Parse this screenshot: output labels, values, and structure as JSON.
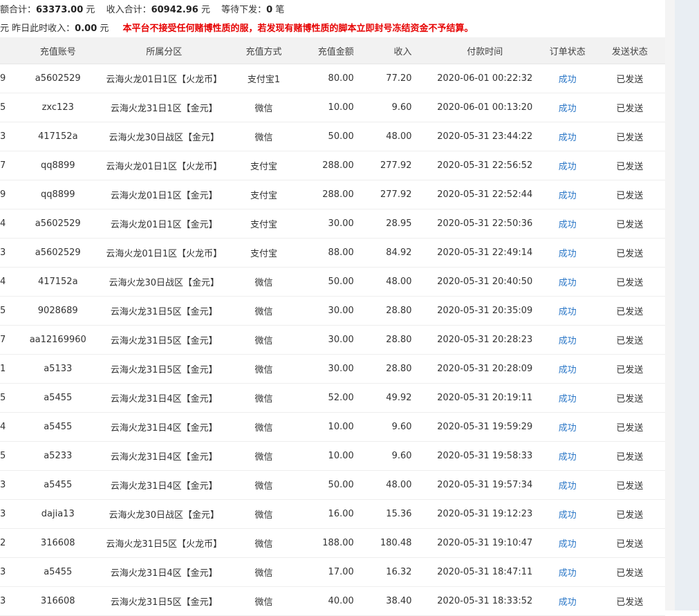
{
  "summary": {
    "total_label": "额合计：",
    "total_value": "63373.00",
    "total_unit": "元",
    "income_label": "收入合计：",
    "income_value": "60942.96",
    "income_unit": "元",
    "pending_label": "等待下发：",
    "pending_value": "0",
    "pending_unit": "笔",
    "unit_prefix": "元",
    "yesterday_label": "昨日此时收入：",
    "yesterday_value": "0.00",
    "yesterday_unit": "元",
    "warning": "本平台不接受任何赌博性质的服，若发现有赌博性质的脚本立即封号冻结资金不予结算。"
  },
  "table": {
    "headers": [
      "",
      "充值账号",
      "所属分区",
      "充值方式",
      "充值金额",
      "收入",
      "付款时间",
      "订单状态",
      "发送状态"
    ],
    "rows": [
      {
        "id": "9",
        "account": "a5602529",
        "zone": "云海火龙01日1区【火龙币】",
        "method": "支付宝1",
        "amount": "80.00",
        "income": "77.20",
        "time": "2020-06-01 00:22:32",
        "status": "成功",
        "send": "已发送"
      },
      {
        "id": "5",
        "account": "zxc123",
        "zone": "云海火龙31日1区【金元】",
        "method": "微信",
        "amount": "10.00",
        "income": "9.60",
        "time": "2020-06-01 00:13:20",
        "status": "成功",
        "send": "已发送"
      },
      {
        "id": "3",
        "account": "417152a",
        "zone": "云海火龙30日战区【金元】",
        "method": "微信",
        "amount": "50.00",
        "income": "48.00",
        "time": "2020-05-31 23:44:22",
        "status": "成功",
        "send": "已发送"
      },
      {
        "id": "7",
        "account": "qq8899",
        "zone": "云海火龙01日1区【火龙币】",
        "method": "支付宝",
        "amount": "288.00",
        "income": "277.92",
        "time": "2020-05-31 22:56:52",
        "status": "成功",
        "send": "已发送"
      },
      {
        "id": "9",
        "account": "qq8899",
        "zone": "云海火龙01日1区【金元】",
        "method": "支付宝",
        "amount": "288.00",
        "income": "277.92",
        "time": "2020-05-31 22:52:44",
        "status": "成功",
        "send": "已发送"
      },
      {
        "id": "4",
        "account": "a5602529",
        "zone": "云海火龙01日1区【金元】",
        "method": "支付宝",
        "amount": "30.00",
        "income": "28.95",
        "time": "2020-05-31 22:50:36",
        "status": "成功",
        "send": "已发送"
      },
      {
        "id": "3",
        "account": "a5602529",
        "zone": "云海火龙01日1区【火龙币】",
        "method": "支付宝",
        "amount": "88.00",
        "income": "84.92",
        "time": "2020-05-31 22:49:14",
        "status": "成功",
        "send": "已发送"
      },
      {
        "id": "4",
        "account": "417152a",
        "zone": "云海火龙30日战区【金元】",
        "method": "微信",
        "amount": "50.00",
        "income": "48.00",
        "time": "2020-05-31 20:40:50",
        "status": "成功",
        "send": "已发送"
      },
      {
        "id": "5",
        "account": "9028689",
        "zone": "云海火龙31日5区【金元】",
        "method": "微信",
        "amount": "30.00",
        "income": "28.80",
        "time": "2020-05-31 20:35:09",
        "status": "成功",
        "send": "已发送"
      },
      {
        "id": "7",
        "account": "aa12169960",
        "zone": "云海火龙31日5区【金元】",
        "method": "微信",
        "amount": "30.00",
        "income": "28.80",
        "time": "2020-05-31 20:28:23",
        "status": "成功",
        "send": "已发送"
      },
      {
        "id": "1",
        "account": "a5133",
        "zone": "云海火龙31日5区【金元】",
        "method": "微信",
        "amount": "30.00",
        "income": "28.80",
        "time": "2020-05-31 20:28:09",
        "status": "成功",
        "send": "已发送"
      },
      {
        "id": "5",
        "account": "a5455",
        "zone": "云海火龙31日4区【金元】",
        "method": "微信",
        "amount": "52.00",
        "income": "49.92",
        "time": "2020-05-31 20:19:11",
        "status": "成功",
        "send": "已发送"
      },
      {
        "id": "4",
        "account": "a5455",
        "zone": "云海火龙31日4区【金元】",
        "method": "微信",
        "amount": "10.00",
        "income": "9.60",
        "time": "2020-05-31 19:59:29",
        "status": "成功",
        "send": "已发送"
      },
      {
        "id": "5",
        "account": "a5233",
        "zone": "云海火龙31日4区【金元】",
        "method": "微信",
        "amount": "10.00",
        "income": "9.60",
        "time": "2020-05-31 19:58:33",
        "status": "成功",
        "send": "已发送"
      },
      {
        "id": "3",
        "account": "a5455",
        "zone": "云海火龙31日4区【金元】",
        "method": "微信",
        "amount": "50.00",
        "income": "48.00",
        "time": "2020-05-31 19:57:34",
        "status": "成功",
        "send": "已发送"
      },
      {
        "id": "3",
        "account": "dajia13",
        "zone": "云海火龙30日战区【金元】",
        "method": "微信",
        "amount": "16.00",
        "income": "15.36",
        "time": "2020-05-31 19:12:23",
        "status": "成功",
        "send": "已发送"
      },
      {
        "id": "2",
        "account": "316608",
        "zone": "云海火龙31日5区【火龙币】",
        "method": "微信",
        "amount": "188.00",
        "income": "180.48",
        "time": "2020-05-31 19:10:47",
        "status": "成功",
        "send": "已发送"
      },
      {
        "id": "3",
        "account": "a5455",
        "zone": "云海火龙31日4区【金元】",
        "method": "微信",
        "amount": "17.00",
        "income": "16.32",
        "time": "2020-05-31 18:47:11",
        "status": "成功",
        "send": "已发送"
      },
      {
        "id": "3",
        "account": "316608",
        "zone": "云海火龙31日5区【金元】",
        "method": "微信",
        "amount": "40.00",
        "income": "38.40",
        "time": "2020-05-31 18:33:52",
        "status": "成功",
        "send": "已发送"
      }
    ]
  },
  "colors": {
    "warning": "#e60000",
    "status_success": "#2b77c7",
    "header_bg": "#f2f2f2"
  }
}
